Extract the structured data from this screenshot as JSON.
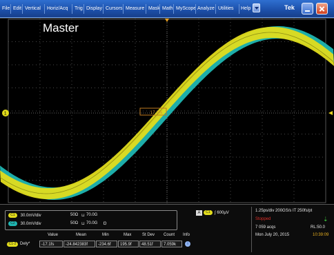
{
  "menu": {
    "items": [
      "File",
      "Edit",
      "Vertical",
      "Horiz/Acq",
      "Trig",
      "Display",
      "Cursors",
      "Measure",
      "Mask",
      "Math",
      "MyScope",
      "Analyze",
      "Utilities",
      "Help"
    ]
  },
  "brand": "Tek",
  "screen": {
    "label": "Master",
    "ref_marker": "1",
    "cursor_readout": "17 1%"
  },
  "channels": [
    {
      "tag": "C1",
      "scale": "30.0mV/div",
      "impedance": "50Ω",
      "bandwidth": "70.0G",
      "color": "#e2dc1c"
    },
    {
      "tag": "C2",
      "scale": "30.0mV/div",
      "impedance": "50Ω",
      "bandwidth": "70.0G",
      "color": "#1fb6b2"
    }
  ],
  "trigger": {
    "tag": "A",
    "channel": "C1",
    "level": "600µV"
  },
  "acquisition": {
    "horizontal": "1.25ps/div 200GS/s   IT    250fs/pt",
    "state": "Stopped",
    "acqs": "7 059 acqs",
    "record_length": "RL:50.0",
    "date": "Mon     July 20, 2015",
    "time": "10:39:09"
  },
  "measurement": {
    "headers": [
      "Value",
      "Mean",
      "Min",
      "Max",
      "St Dev",
      "Count",
      "Info"
    ],
    "row": {
      "tag": "C1-2",
      "name": "Dely*",
      "value": "-17.1fs",
      "mean": "-24.842383f",
      "min": "-234.6f",
      "max": "195.9f",
      "stdev": "48.51f",
      "count": "7.059k"
    }
  },
  "colors": {
    "ch1": "#e2dc1c",
    "ch2": "#1fb6b2",
    "stopped": "#e0302a",
    "time": "#e8b020",
    "menubar": "#1c4fa8"
  }
}
